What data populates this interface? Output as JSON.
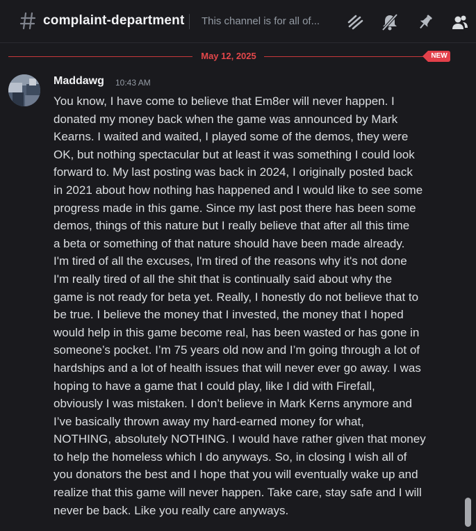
{
  "header": {
    "channel_name": "complaint-department",
    "topic": "This channel is for all of...",
    "icons": [
      "threads-icon",
      "notification-muted-icon",
      "pin-icon",
      "member-list-icon"
    ]
  },
  "divider": {
    "date": "May 12, 2025",
    "new_label": "NEW"
  },
  "message": {
    "author": "Maddawg",
    "timestamp": "10:43 AM",
    "lines": [
      "You know, I have come to believe that Em8er will never happen. I",
      "donated my money back when the game was announced by Mark",
      "Kearns. I waited and waited, I played some of the demos, they were",
      "OK, but nothing spectacular but at least it was something I could look",
      "forward to. My last posting was back in 2024, I originally posted back",
      "in 2021 about how nothing has happened and I would like to see some",
      "progress made in this game. Since my last post there has been some",
      "demos, things of this nature but I really believe that after all this time",
      "a beta or something of that nature should have been made already.",
      "I'm tired of all the excuses, I'm tired of the reasons why it's not done",
      "I'm really tired of all the shit that is continually said about why the",
      "game is not ready for beta yet. Really, I honestly do not believe that to",
      "be true. I believe the money that I invested, the money that I hoped",
      "would help in this game become real, has been wasted or has gone in",
      "someone’s pocket. I’m 75 years old now and I’m going through a lot of",
      "hardships and a lot of health issues that will never ever go away. I was",
      "hoping to have a game that I could play, like I did with Firefall,",
      "obviously I was mistaken. I don’t believe in Mark Kerns anymore and",
      "I’ve basically thrown away my hard-earned money for what,",
      "NOTHING, absolutely NOTHING. I would have rather given that money",
      "to help the homeless which I do anyways. So, in closing I wish all of",
      "you donators the best and I hope that you will eventually wake up and",
      "realize that this game will never happen. Take care, stay safe and I will",
      "never be back. Like you really care anyways."
    ]
  },
  "colors": {
    "background": "#1a1a1e",
    "new_red": "#e3404a",
    "text": "#dbdee1",
    "muted": "#949ba4"
  }
}
